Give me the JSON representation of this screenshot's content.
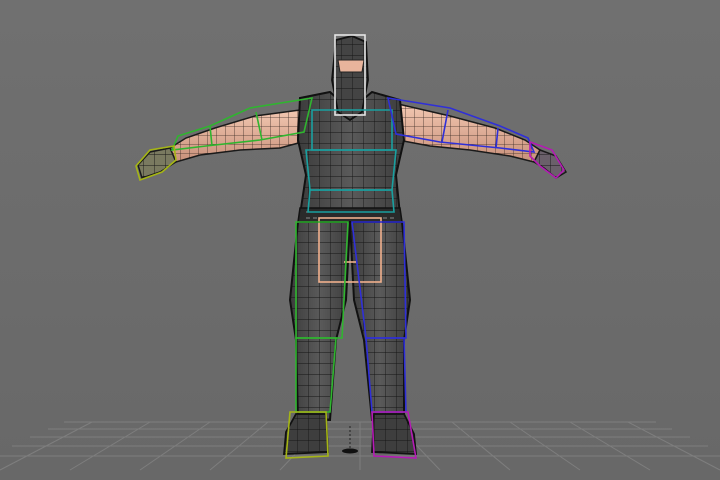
{
  "viewport": {
    "view": "front",
    "shading": "wireframe-on-shaded",
    "background_color": "#6c6c6c",
    "grid_color": "#7e7e7e"
  },
  "model": {
    "pose": "t-pose",
    "skin_color": "#e8b49c",
    "cloth_color": "#4a4a4a",
    "wire_color": "#1a1a1a"
  },
  "rig": {
    "bone_colors": {
      "head": "#e6e6e6",
      "spine": "#19a0a0",
      "pelvis": "#f0b08c",
      "left_arm": "#2fb52f",
      "right_arm": "#2f2fd8",
      "left_hand": "#a5b515",
      "right_hand": "#b51ab5",
      "left_leg": "#2fb52f",
      "right_leg": "#2f2fd8",
      "left_foot": "#a5b515",
      "right_foot": "#b51ab5"
    }
  }
}
